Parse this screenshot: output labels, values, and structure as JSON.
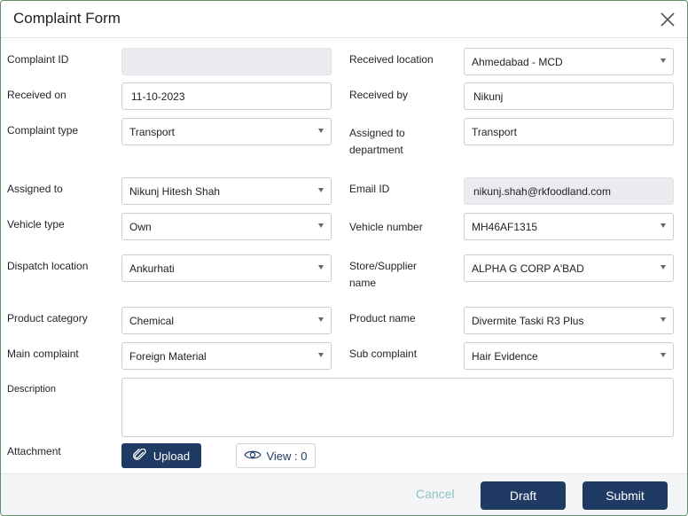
{
  "dialog": {
    "title": "Complaint Form",
    "close_icon": "close-icon"
  },
  "fields": {
    "complaint_id": {
      "label": "Complaint ID",
      "value": ""
    },
    "received_location": {
      "label": "Received location",
      "value": "Ahmedabad - MCD"
    },
    "received_on": {
      "label": "Received on",
      "value": "11-10-2023"
    },
    "received_by": {
      "label": "Received by",
      "value": "Nikunj"
    },
    "complaint_type": {
      "label": "Complaint type",
      "value": "Transport"
    },
    "assigned_to_department": {
      "label_line1": "Assigned to",
      "label_line2": "department",
      "value": "Transport"
    },
    "assigned_to": {
      "label": "Assigned to",
      "value": "Nikunj Hitesh Shah"
    },
    "email_id": {
      "label": "Email ID",
      "value": "nikunj.shah@rkfoodland.com"
    },
    "vehicle_type": {
      "label": "Vehicle type",
      "value": "Own"
    },
    "vehicle_number": {
      "label": "Vehicle number",
      "value": "MH46AF1315"
    },
    "dispatch_location": {
      "label": "Dispatch location",
      "value": "Ankurhati"
    },
    "store_supplier": {
      "label_line1": "Store/Supplier",
      "label_line2": "name",
      "value": "ALPHA G CORP A'BAD"
    },
    "product_category": {
      "label": "Product category",
      "value": "Chemical"
    },
    "product_name": {
      "label": "Product name",
      "value": "Divermite Taski R3 Plus"
    },
    "main_complaint": {
      "label": "Main complaint",
      "value": "Foreign Material"
    },
    "sub_complaint": {
      "label": "Sub complaint",
      "value": "Hair Evidence"
    },
    "description": {
      "label": "Description",
      "value": ""
    },
    "attachment": {
      "label": "Attachment",
      "upload_label": "Upload",
      "view_label": "View : 0"
    }
  },
  "footer": {
    "cancel_label": "Cancel",
    "draft_label": "Draft",
    "submit_label": "Submit"
  },
  "colors": {
    "primary": "#1f3a63",
    "cancel_text": "#8fbfc4",
    "readonly_bg": "#e9ebee",
    "footer_bg": "#f4f5f7"
  }
}
